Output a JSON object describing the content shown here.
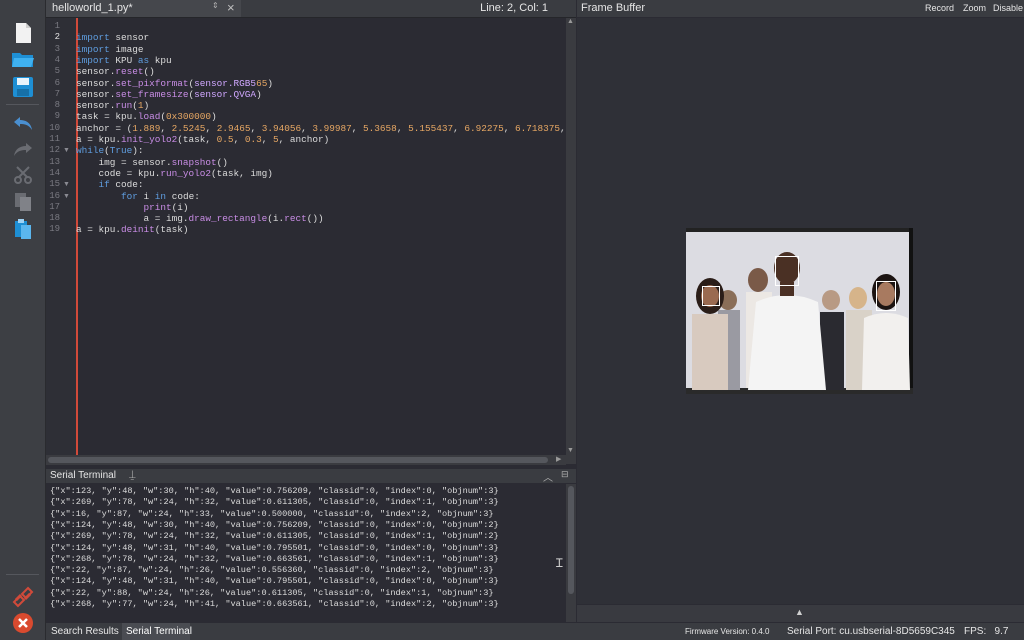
{
  "editor": {
    "tab_title": "helloworld_1.py*",
    "cursor_position": "Line: 2, Col: 1",
    "code_lines": [
      "",
      "import sensor",
      "import image",
      "import KPU as kpu",
      "sensor.reset()",
      "sensor.set_pixformat(sensor.RGB565)",
      "sensor.set_framesize(sensor.QVGA)",
      "sensor.run(1)",
      "task = kpu.load(0x300000)",
      "anchor = (1.889, 2.5245, 2.9465, 3.94056, 3.99987, 5.3658, 5.155437, 6.92275, 6.718375, 9.01025)",
      "a = kpu.init_yolo2(task, 0.5, 0.3, 5, anchor)",
      "while(True):",
      "    img = sensor.snapshot()",
      "    code = kpu.run_yolo2(task, img)",
      "    if code:",
      "        for i in code:",
      "            print(i)",
      "            a = img.draw_rectangle(i.rect())",
      "a = kpu.deinit(task)"
    ]
  },
  "frame_buffer": {
    "title": "Frame Buffer",
    "record_label": "Record",
    "zoom_label": "Zoom",
    "disable_label": "Disable"
  },
  "terminal": {
    "title": "Serial Terminal",
    "lines": [
      "{\"x\":123, \"y\":48, \"w\":30, \"h\":40, \"value\":0.756209, \"classid\":0, \"index\":0, \"objnum\":3}",
      "{\"x\":269, \"y\":78, \"w\":24, \"h\":32, \"value\":0.611305, \"classid\":0, \"index\":1, \"objnum\":3}",
      "{\"x\":16, \"y\":87, \"w\":24, \"h\":33, \"value\":0.500000, \"classid\":0, \"index\":2, \"objnum\":3}",
      "{\"x\":124, \"y\":48, \"w\":30, \"h\":40, \"value\":0.756209, \"classid\":0, \"index\":0, \"objnum\":2}",
      "{\"x\":269, \"y\":78, \"w\":24, \"h\":32, \"value\":0.611305, \"classid\":0, \"index\":1, \"objnum\":2}",
      "{\"x\":124, \"y\":48, \"w\":31, \"h\":40, \"value\":0.795501, \"classid\":0, \"index\":0, \"objnum\":3}",
      "{\"x\":268, \"y\":78, \"w\":24, \"h\":32, \"value\":0.663561, \"classid\":0, \"index\":1, \"objnum\":3}",
      "{\"x\":22, \"y\":87, \"w\":24, \"h\":26, \"value\":0.556360, \"classid\":0, \"index\":2, \"objnum\":3}",
      "{\"x\":124, \"y\":48, \"w\":31, \"h\":40, \"value\":0.795501, \"classid\":0, \"index\":0, \"objnum\":3}",
      "{\"x\":22, \"y\":88, \"w\":24, \"h\":26, \"value\":0.611305, \"classid\":0, \"index\":1, \"objnum\":3}",
      "{\"x\":268, \"y\":77, \"w\":24, \"h\":41, \"value\":0.663561, \"classid\":0, \"index\":2, \"objnum\":3}"
    ]
  },
  "statusbar": {
    "tab_search_results": "Search Results",
    "tab_serial_terminal": "Serial Terminal",
    "firmware": "Firmware Version: 0.4.0",
    "serial_port": "Serial Port: cu.usbserial-8D5659C345",
    "fps": "FPS:   9.7"
  },
  "colors": {
    "accent_red": "#d14a3a",
    "keyword": "#5f9ddf",
    "function": "#c98de6",
    "number": "#e8a864"
  }
}
